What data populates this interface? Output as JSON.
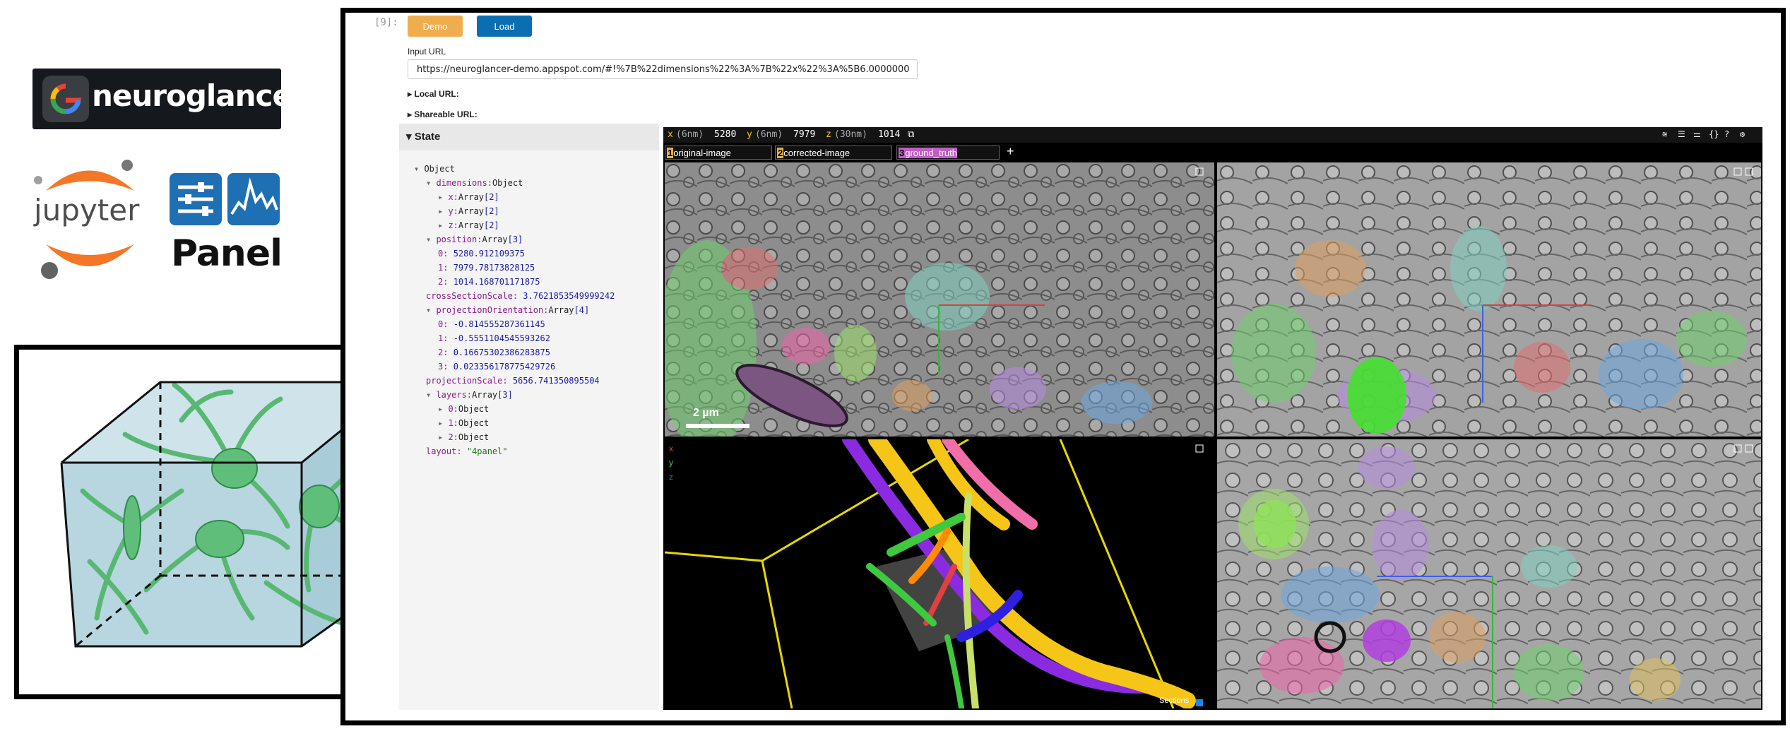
{
  "logos": {
    "neuroglancer": "neuroglancer",
    "jupyter": "jupyter",
    "panel": "Panel"
  },
  "notebook": {
    "prompt": "[9]:",
    "buttons": {
      "demo": "Demo",
      "load": "Load"
    },
    "input_label": "Input URL",
    "input_value": "https://neuroglancer-demo.appspot.com/#!%7B%22dimensions%22%3A%7B%22x%22%3A%5B6.0000000",
    "local_url": "Local URL:",
    "shareable_url": "Shareable URL:",
    "state_title": "State"
  },
  "state_tree": {
    "root": "Object",
    "dimensions": {
      "key": "dimensions:",
      "type": "Object"
    },
    "dim_x": {
      "key": "x:",
      "type": "Array",
      "len": "[2]"
    },
    "dim_y": {
      "key": "y:",
      "type": "Array",
      "len": "[2]"
    },
    "dim_z": {
      "key": "z:",
      "type": "Array",
      "len": "[2]"
    },
    "position": {
      "key": "position:",
      "type": "Array",
      "len": "[3]"
    },
    "pos0": {
      "key": "0:",
      "value": "5280.912109375"
    },
    "pos1": {
      "key": "1:",
      "value": "7979.78173828125"
    },
    "pos2": {
      "key": "2:",
      "value": "1014.168701171875"
    },
    "crossSectionScale": {
      "key": "crossSectionScale:",
      "value": "3.7621853549999242"
    },
    "projectionOrientation": {
      "key": "projectionOrientation:",
      "type": "Array",
      "len": "[4]"
    },
    "po0": {
      "key": "0:",
      "value": "-0.814555287361145"
    },
    "po1": {
      "key": "1:",
      "value": "-0.5551104545593262"
    },
    "po2": {
      "key": "2:",
      "value": "0.16675302386283875"
    },
    "po3": {
      "key": "3:",
      "value": "0.023356178775429726"
    },
    "projectionScale": {
      "key": "projectionScale:",
      "value": "5656.741350895504"
    },
    "layers": {
      "key": "layers:",
      "type": "Array",
      "len": "[3]"
    },
    "l0": {
      "key": "0:",
      "type": "Object"
    },
    "l1": {
      "key": "1:",
      "type": "Object"
    },
    "l2": {
      "key": "2:",
      "type": "Object"
    },
    "layout": {
      "key": "layout:",
      "value": "\"4panel\""
    }
  },
  "viewer": {
    "coords": {
      "x_label": "x",
      "x_unit": "(6nm)",
      "x_value": "5280",
      "y_label": "y",
      "y_unit": "(6nm)",
      "y_value": "7979",
      "z_label": "z",
      "z_unit": "(30nm)",
      "z_value": "1014"
    },
    "layers": [
      {
        "num": "1",
        "name": "original-image",
        "color": "#e8b13a"
      },
      {
        "num": "2",
        "name": "corrected-image",
        "color": "#e8b13a"
      },
      {
        "num": "3",
        "name": "ground_truth",
        "color": "#c25dc7"
      }
    ],
    "add_layer": "+",
    "scale_bar": "2 µm",
    "sections_label": "Sections",
    "axis_x": "x",
    "axis_y": "y",
    "axis_z": "z"
  },
  "colors": {
    "demo_button": "#f0ad4e",
    "load_button": "#0b6eb1",
    "mesh_yellow": "#f5c518",
    "mesh_purple": "#8a2be2",
    "mesh_pink": "#f06fa8",
    "mesh_green": "#3ec93e",
    "cube_fill": "#b8d6df",
    "neuron_green": "#58b873"
  }
}
